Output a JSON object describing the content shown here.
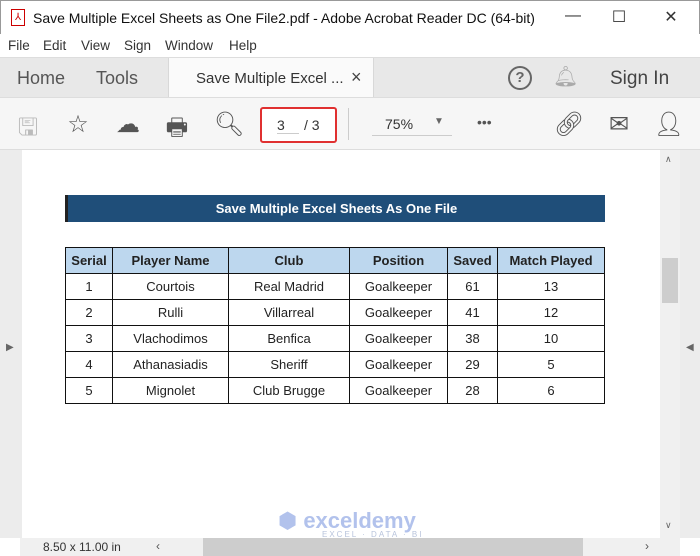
{
  "window": {
    "title": "Save Multiple Excel Sheets as One File2.pdf - Adobe Acrobat Reader DC (64-bit)",
    "minimize": "—",
    "maximize": "☐",
    "close": "✕"
  },
  "menu": [
    "File",
    "Edit",
    "View",
    "Sign",
    "Window",
    "Help"
  ],
  "tabs": {
    "home": "Home",
    "tools": "Tools",
    "active": "Save Multiple Excel ...",
    "close": "×",
    "sign_in": "Sign In"
  },
  "toolbar": {
    "page_current": "3",
    "page_total": "/ 3",
    "zoom": "75%",
    "more": "•••"
  },
  "document": {
    "title": "Save Multiple Excel Sheets As One File",
    "headers": [
      "Serial",
      "Player Name",
      "Club",
      "Position",
      "Saved",
      "Match Played"
    ],
    "rows": [
      [
        "1",
        "Courtois",
        "Real Madrid",
        "Goalkeeper",
        "61",
        "13"
      ],
      [
        "2",
        "Rulli",
        "Villarreal",
        "Goalkeeper",
        "41",
        "12"
      ],
      [
        "3",
        "Vlachodimos",
        "Benfica",
        "Goalkeeper",
        "38",
        "10"
      ],
      [
        "4",
        "Athanasiadis",
        "Sheriff",
        "Goalkeeper",
        "29",
        "5"
      ],
      [
        "5",
        "Mignolet",
        "Club Brugge",
        "Goalkeeper",
        "28",
        "6"
      ]
    ]
  },
  "watermark": {
    "name": "exceldemy",
    "tagline": "EXCEL · DATA · BI"
  },
  "status": {
    "page_size": "8.50 x 11.00 in"
  },
  "colors": {
    "title_bg": "#1f4e79",
    "header_bg": "#bdd7ee",
    "page_box_border": "#e03030"
  }
}
